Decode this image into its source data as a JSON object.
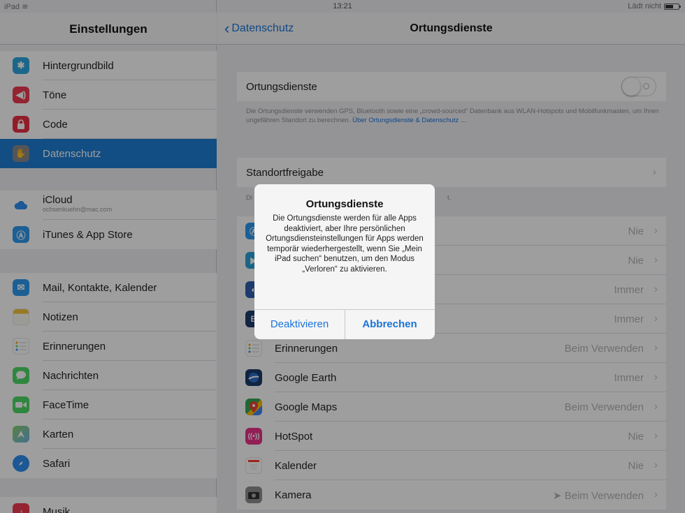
{
  "status": {
    "carrier": "iPad",
    "wifi_icon": "wifi-icon",
    "time": "13:21",
    "charge": "Lädt nicht"
  },
  "sidebar": {
    "title": "Einstellungen",
    "items": [
      {
        "label": "Hintergrundbild",
        "icon": "wallpaper-icon",
        "color": "#2da7e0"
      },
      {
        "label": "Töne",
        "icon": "sounds-icon",
        "color": "#ef3b4f"
      },
      {
        "label": "Code",
        "icon": "lock-icon",
        "color": "#ec2f45"
      },
      {
        "label": "Datenschutz",
        "icon": "hand-icon",
        "color": "#8a8a8f",
        "selected": true
      },
      {
        "label": "iCloud",
        "sublabel": "ochsenkuehn@mac.com",
        "icon": "icloud-icon",
        "color": "#2d8ff0"
      },
      {
        "label": "iTunes & App Store",
        "icon": "app-store-icon",
        "color": "#2d9af0"
      },
      {
        "label": "Mail, Kontakte, Kalender",
        "icon": "mail-icon",
        "color": "#2d9af0"
      },
      {
        "label": "Notizen",
        "icon": "notes-icon",
        "color": "#f5c53a"
      },
      {
        "label": "Erinnerungen",
        "icon": "reminders-icon",
        "color": "#ffffff"
      },
      {
        "label": "Nachrichten",
        "icon": "messages-icon",
        "color": "#4cd964"
      },
      {
        "label": "FaceTime",
        "icon": "facetime-icon",
        "color": "#4cd964"
      },
      {
        "label": "Karten",
        "icon": "maps-icon",
        "color": "#6db3e8"
      },
      {
        "label": "Safari",
        "icon": "safari-icon",
        "color": "#2d8ff0"
      },
      {
        "label": "Musik",
        "icon": "music-icon",
        "color": "#ef3b4f"
      }
    ]
  },
  "main": {
    "back_label": "Datenschutz",
    "title": "Ortungsdienste",
    "toggle_label": "Ortungsdienste",
    "toggle_on": false,
    "footnote": "Die Ortungsdienste verwenden GPS, Bluetooth sowie eine „crowd-sourced“ Datenbank aus WLAN-Hotspots und Mobilfunkmasten, um Ihren ungefähren Standort zu berechnen.",
    "footnote_link": "Über Ortungsdienste & Datenschutz …",
    "share_label": "Standortfreigabe",
    "share_note_start": "Di",
    "share_note_end": "t.",
    "apps": [
      {
        "label": "",
        "value": "Nie",
        "icon": "app-store-icon",
        "color": "#2d9af0"
      },
      {
        "label": "",
        "value": "Nie",
        "icon": "app-icon",
        "color": "#2aa3d8"
      },
      {
        "label": "",
        "value": "Immer",
        "icon": "app-icon",
        "color": "#3060b0"
      },
      {
        "label": "",
        "value": "Immer",
        "icon": "app-icon",
        "color": "#1d3d6e"
      },
      {
        "label": "Erinnerungen",
        "value": "Beim Verwenden",
        "icon": "reminders-icon",
        "color": "#ffffff"
      },
      {
        "label": "Google Earth",
        "value": "Immer",
        "icon": "google-earth-icon",
        "color": "#1b3a6b"
      },
      {
        "label": "Google Maps",
        "value": "Beim Verwenden",
        "icon": "google-maps-icon",
        "color": "#34a853"
      },
      {
        "label": "HotSpot",
        "value": "Nie",
        "icon": "hotspot-icon",
        "color": "#e8338c"
      },
      {
        "label": "Kalender",
        "value": "Nie",
        "icon": "calendar-icon",
        "color": "#ffffff"
      },
      {
        "label": "Kamera",
        "value": "Beim Verwenden",
        "icon": "camera-icon",
        "color": "#8e8e93",
        "location_arrow": true
      }
    ]
  },
  "alert": {
    "title": "Ortungsdienste",
    "message": "Die Ortungsdienste werden für alle Apps deaktiviert, aber Ihre persönlichen Ortungsdiensteinstellungen für Apps werden temporär wiederhergestellt, wenn Sie „Mein iPad suchen“ benutzen, um den Modus „Verloren“ zu aktivieren.",
    "button_left": "Deaktivieren",
    "button_right": "Abbrechen"
  }
}
